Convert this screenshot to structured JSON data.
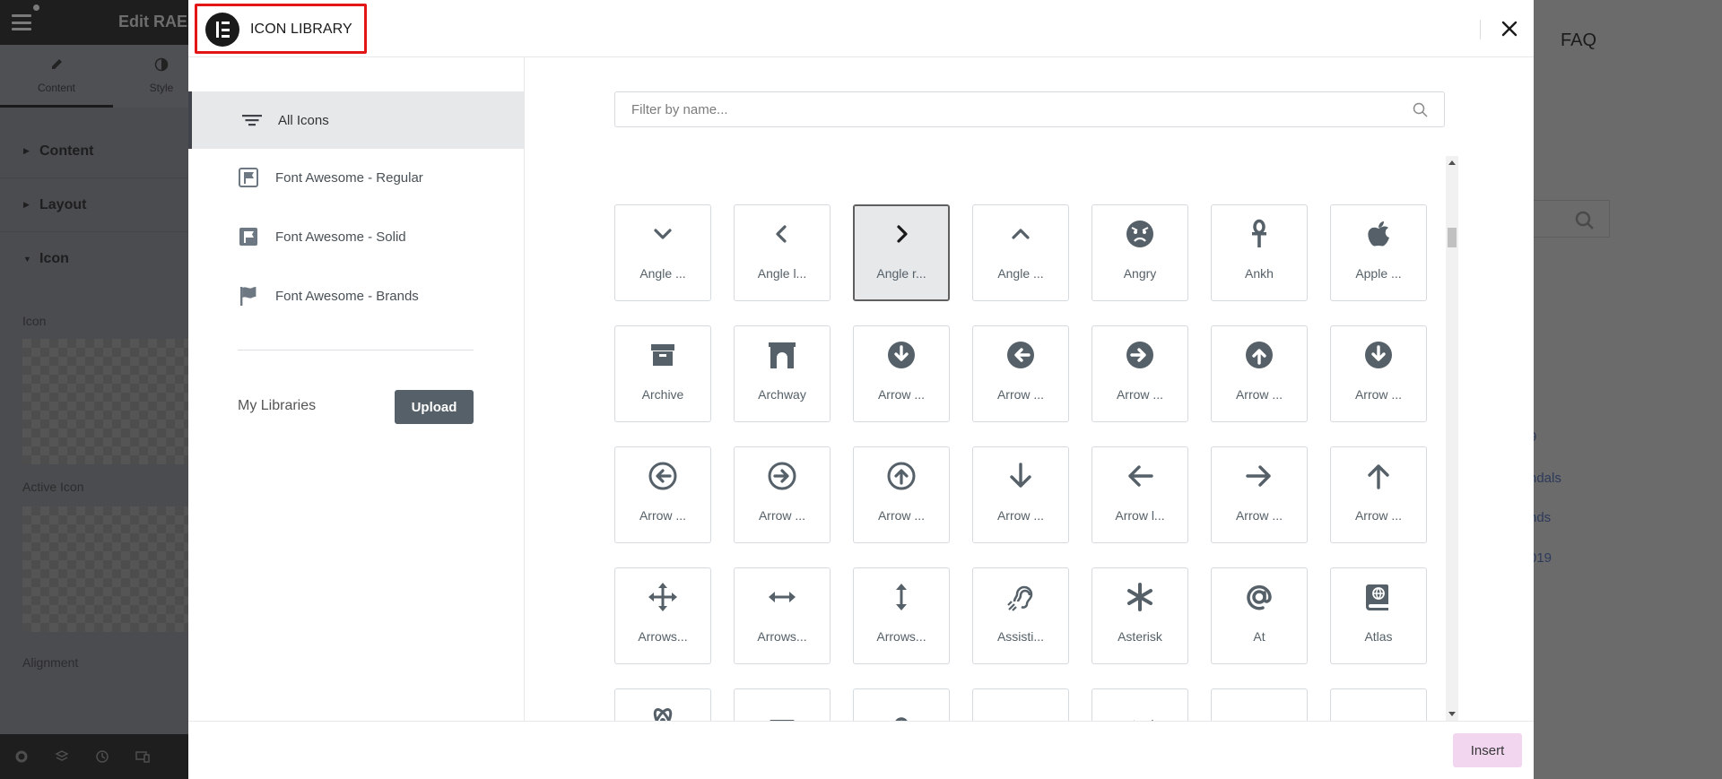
{
  "colors": {
    "accent_highlight": "#e41515",
    "upload_button": "#556068",
    "insert_button": "#f2d6f0",
    "icon_gray": "#556068",
    "active_tab_bg": "#e6e8ea"
  },
  "editor": {
    "title": "Edit RAE",
    "tabs": [
      {
        "label": "Content",
        "icon": "pencil-icon"
      },
      {
        "label": "Style",
        "icon": "contrast-icon"
      }
    ],
    "sections": [
      {
        "label": "Content",
        "icon": "caret-right-icon"
      },
      {
        "label": "Layout",
        "icon": "caret-right-icon"
      },
      {
        "label": "Icon",
        "icon": "caret-down-icon"
      }
    ],
    "fields": {
      "icon_label": "Icon",
      "active_icon_label": "Active Icon",
      "alignment_label": "Alignment"
    }
  },
  "site": {
    "faq": "FAQ",
    "links": [
      "9",
      "ndals",
      "nds",
      "019"
    ]
  },
  "modal": {
    "title": "ICON LIBRARY",
    "close_icon": "close-icon",
    "tabs": [
      {
        "label": "All Icons",
        "icon": "filter-lines-icon",
        "active": true
      },
      {
        "label": "Font Awesome - Regular",
        "icon": "flag-outline-icon",
        "active": false
      },
      {
        "label": "Font Awesome - Solid",
        "icon": "flag-square-icon",
        "active": false
      },
      {
        "label": "Font Awesome - Brands",
        "icon": "flag-icon",
        "active": false
      }
    ],
    "my_libraries": "My Libraries",
    "upload_label": "Upload",
    "filter_placeholder": "Filter by name...",
    "filter_value": "",
    "insert_label": "Insert",
    "icons": [
      {
        "name": "Angle ...",
        "icon": "angle-down-icon",
        "selected": false
      },
      {
        "name": "Angle l...",
        "icon": "angle-left-icon",
        "selected": false
      },
      {
        "name": "Angle r...",
        "icon": "angle-right-icon",
        "selected": true
      },
      {
        "name": "Angle ...",
        "icon": "angle-up-icon",
        "selected": false
      },
      {
        "name": "Angry",
        "icon": "angry-icon",
        "selected": false
      },
      {
        "name": "Ankh",
        "icon": "ankh-icon",
        "selected": false
      },
      {
        "name": "Apple ...",
        "icon": "apple-icon",
        "selected": false
      },
      {
        "name": "Archive",
        "icon": "archive-icon",
        "selected": false
      },
      {
        "name": "Archway",
        "icon": "archway-icon",
        "selected": false
      },
      {
        "name": "Arrow ...",
        "icon": "arrow-circle-down-icon",
        "selected": false
      },
      {
        "name": "Arrow ...",
        "icon": "arrow-circle-left-icon",
        "selected": false
      },
      {
        "name": "Arrow ...",
        "icon": "arrow-circle-right-icon",
        "selected": false
      },
      {
        "name": "Arrow ...",
        "icon": "arrow-circle-up-icon",
        "selected": false
      },
      {
        "name": "Arrow ...",
        "icon": "arrow-circle-down-alt-icon",
        "selected": false
      },
      {
        "name": "Arrow ...",
        "icon": "arrow-circle-left-outline-icon",
        "selected": false
      },
      {
        "name": "Arrow ...",
        "icon": "arrow-circle-right-outline-icon",
        "selected": false
      },
      {
        "name": "Arrow ...",
        "icon": "arrow-circle-up-outline-icon",
        "selected": false
      },
      {
        "name": "Arrow ...",
        "icon": "arrow-down-icon",
        "selected": false
      },
      {
        "name": "Arrow l...",
        "icon": "arrow-left-icon",
        "selected": false
      },
      {
        "name": "Arrow ...",
        "icon": "arrow-right-icon",
        "selected": false
      },
      {
        "name": "Arrow ...",
        "icon": "arrow-up-icon",
        "selected": false
      },
      {
        "name": "Arrows...",
        "icon": "arrows-move-icon",
        "selected": false
      },
      {
        "name": "Arrows...",
        "icon": "arrows-horizontal-icon",
        "selected": false
      },
      {
        "name": "Arrows...",
        "icon": "arrows-vertical-icon",
        "selected": false
      },
      {
        "name": "Assisti...",
        "icon": "assistive-listening-icon",
        "selected": false
      },
      {
        "name": "Asterisk",
        "icon": "asterisk-icon",
        "selected": false
      },
      {
        "name": "At",
        "icon": "at-icon",
        "selected": false
      },
      {
        "name": "Atlas",
        "icon": "atlas-icon",
        "selected": false
      },
      {
        "name": "",
        "icon": "atom-icon",
        "selected": false
      },
      {
        "name": "",
        "icon": "audio-description-icon",
        "selected": false
      },
      {
        "name": "",
        "icon": "award-icon",
        "selected": false
      },
      {
        "name": "",
        "icon": "baby-icon",
        "selected": false
      },
      {
        "name": "",
        "icon": "baby-carriage-icon",
        "selected": false
      },
      {
        "name": "",
        "icon": "backspace-icon",
        "selected": false
      },
      {
        "name": "",
        "icon": "backward-icon",
        "selected": false
      }
    ]
  }
}
